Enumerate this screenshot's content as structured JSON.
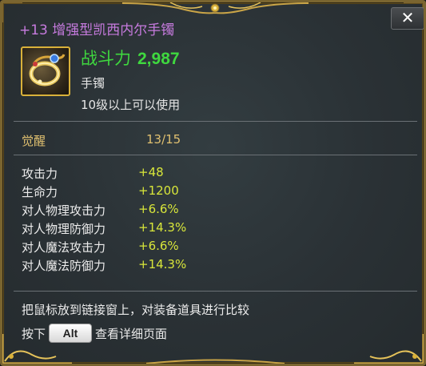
{
  "item": {
    "title": "+13 增强型凯西内尔手镯",
    "icon": "bracelet-icon",
    "combat_label": "战斗力",
    "combat_value": "2,987",
    "type": "手镯",
    "level_requirement": "10级以上可以使用"
  },
  "awakening": {
    "label": "觉醒",
    "value": "13/15"
  },
  "stats": [
    {
      "name": "攻击力",
      "value": "+48"
    },
    {
      "name": "生命力",
      "value": "+1200"
    },
    {
      "name": "对人物理攻击力",
      "value": "+6.6%"
    },
    {
      "name": "对人物理防御力",
      "value": "+14.3%"
    },
    {
      "name": "对人魔法攻击力",
      "value": "+6.6%"
    },
    {
      "name": "对人魔法防御力",
      "value": "+14.3%"
    }
  ],
  "hints": {
    "compare": "把鼠标放到链接窗上，对装备道具进行比较",
    "press": "按下",
    "key": "Alt",
    "detail": "查看详细页面"
  },
  "close_label": "✕",
  "colors": {
    "title": "#c77bdf",
    "combat": "#3fd83f",
    "awakening": "#e0c070",
    "stat_value": "#d8e63a",
    "border_gold": "#7a6530"
  }
}
